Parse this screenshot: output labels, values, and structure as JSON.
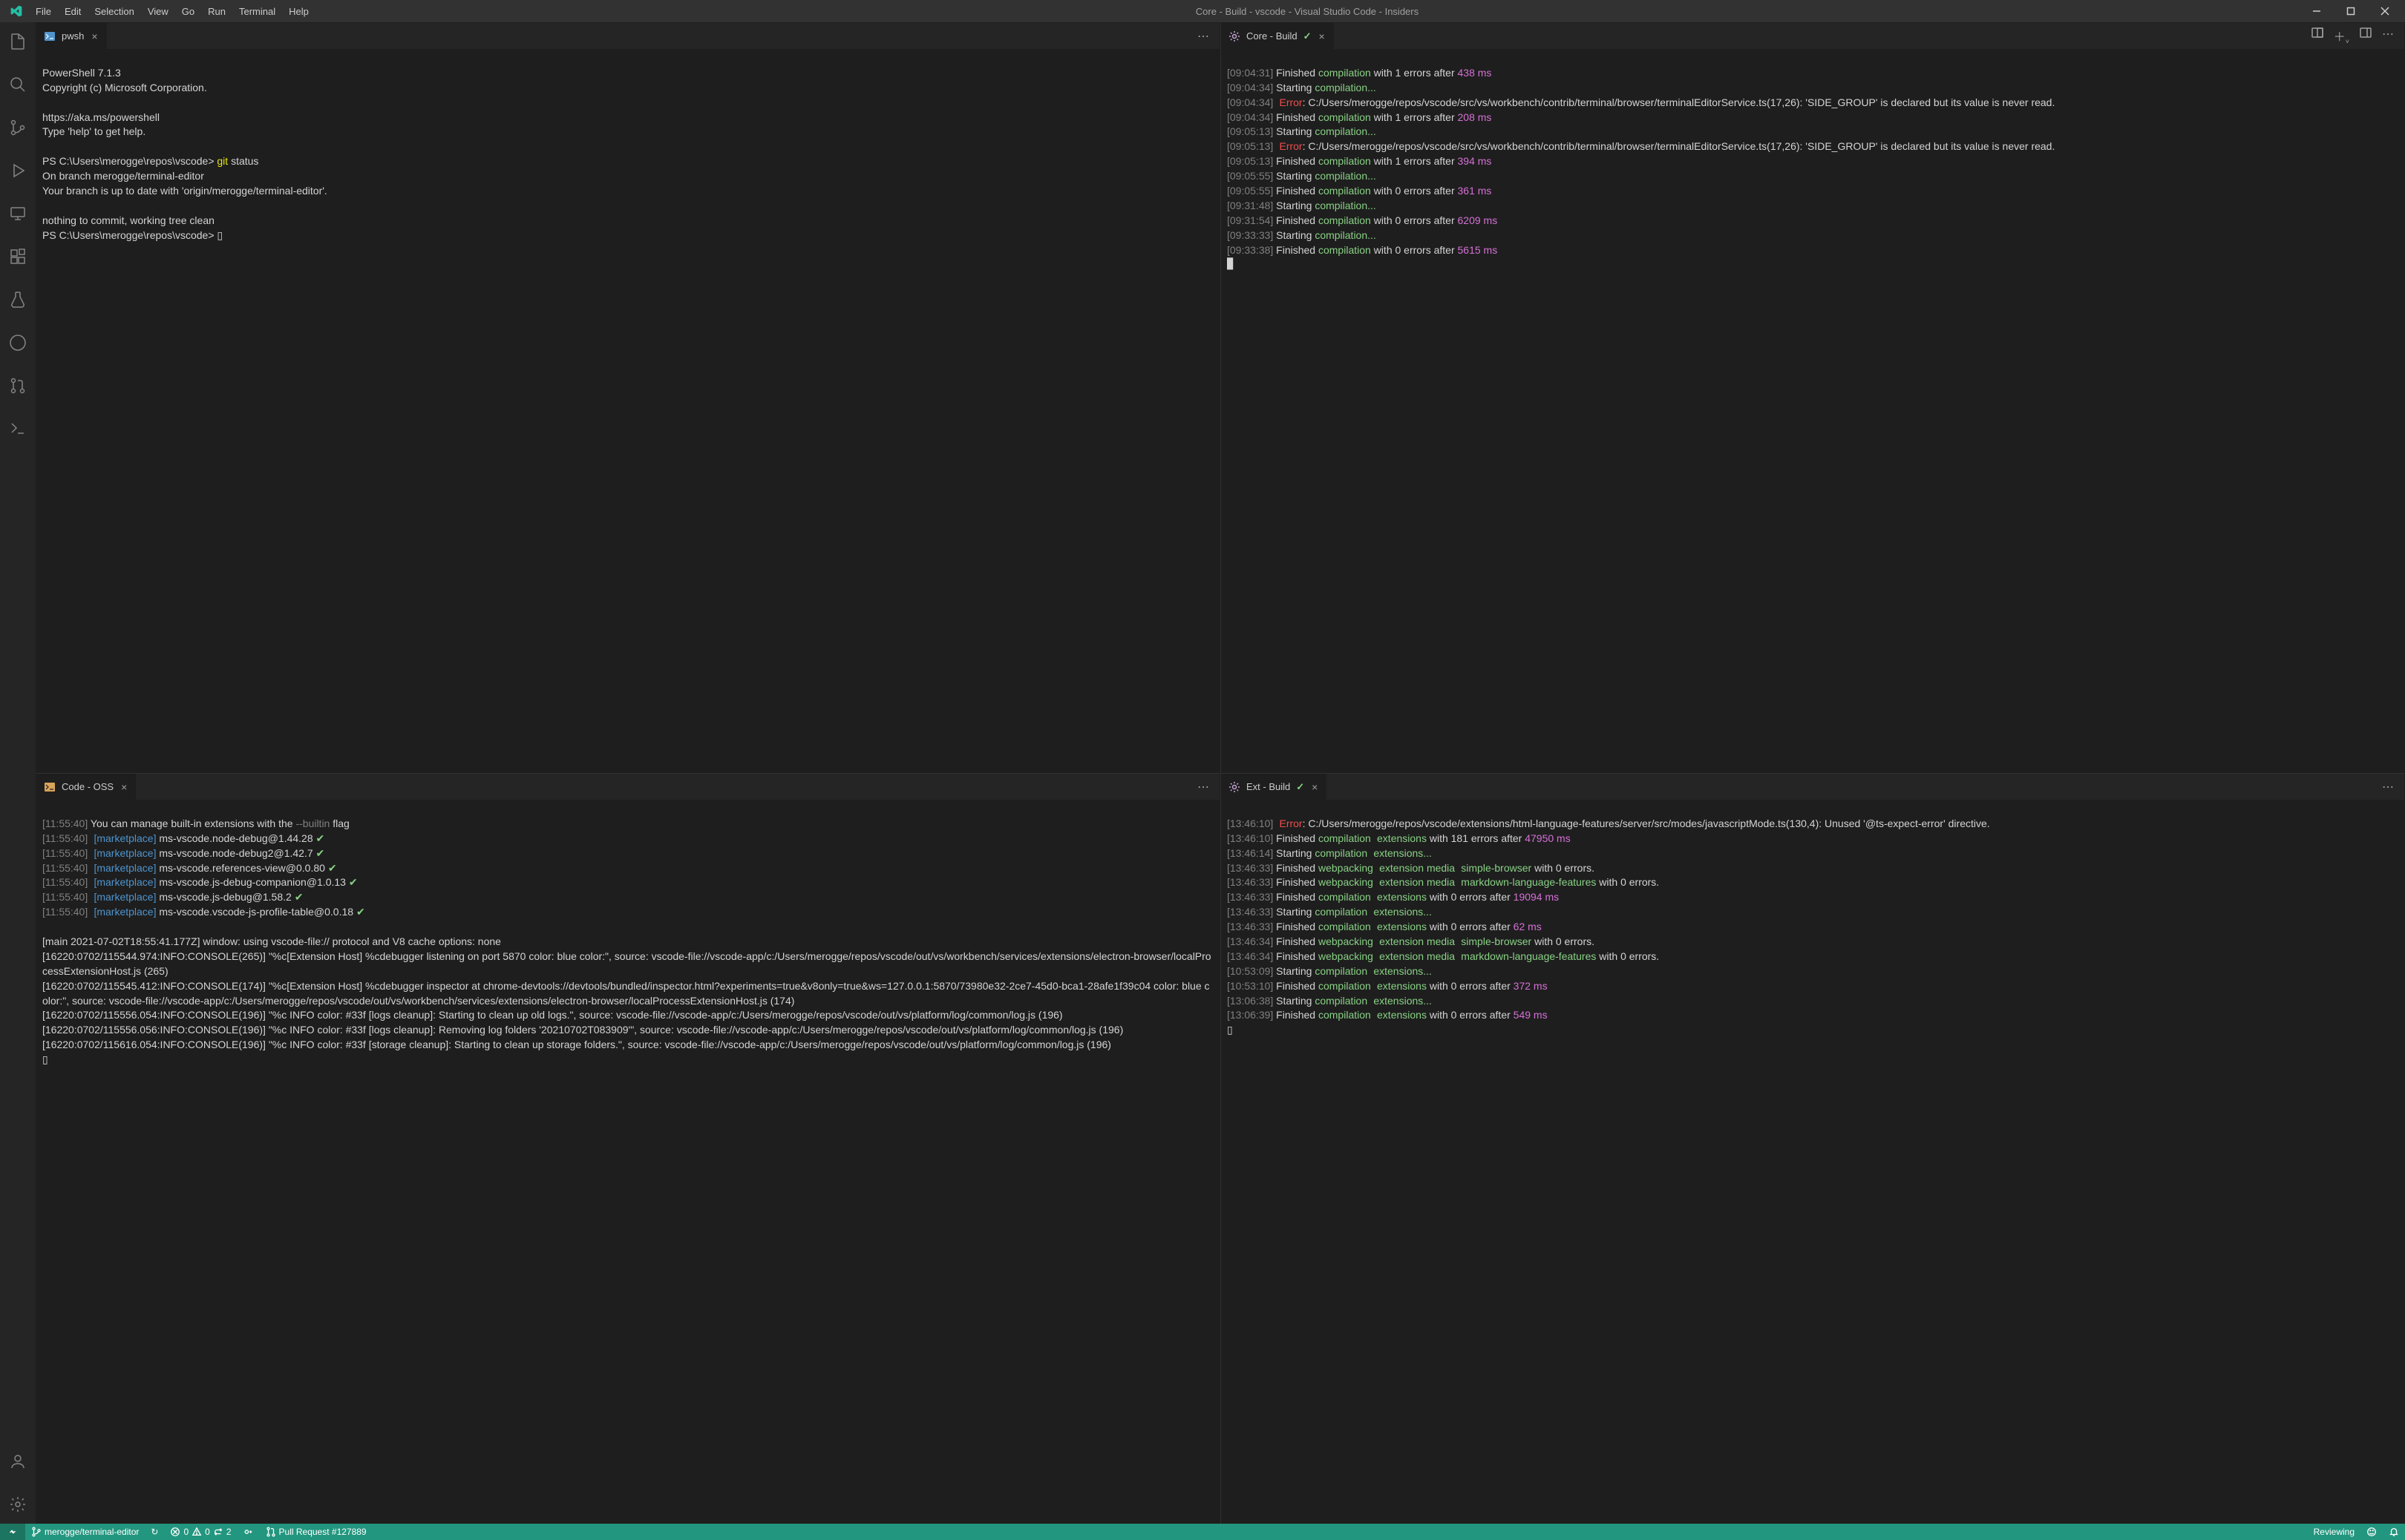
{
  "app": {
    "title": "Core - Build - vscode - Visual Studio Code - Insiders"
  },
  "menu": {
    "items": [
      "File",
      "Edit",
      "Selection",
      "View",
      "Go",
      "Run",
      "Terminal",
      "Help"
    ]
  },
  "panes": {
    "tl": {
      "tab": "pwsh"
    },
    "tr": {
      "tab": "Core - Build"
    },
    "bl": {
      "tab": "Code - OSS"
    },
    "br": {
      "tab": "Ext - Build"
    }
  },
  "term_tl": {
    "l00": "PowerShell 7.1.3",
    "l01": "Copyright (c) Microsoft Corporation.",
    "l02": "",
    "l03": "https://aka.ms/powershell",
    "l04": "Type 'help' to get help.",
    "l05": "",
    "p06": "PS C:\\Users\\merogge\\repos\\vscode> ",
    "c06a": "git",
    "c06b": " status",
    "l07": "On branch merogge/terminal-editor",
    "l08": "Your branch is up to date with 'origin/merogge/terminal-editor'.",
    "l09": "",
    "l10": "nothing to commit, working tree clean",
    "p11": "PS C:\\Users\\merogge\\repos\\vscode> ",
    "cursor": "▯"
  },
  "finished": " Finished ",
  "starting": " Starting ",
  "error_word": "Error",
  "compilation_word": "compilation",
  "compilation_dots": "compilation...",
  "extensions_word": "extensions",
  "extensions_dots": "extensions...",
  "webpacking_word": "webpacking",
  "extension_media": "extension media",
  "term_tr": {
    "r00": {
      "ts": "[09:04:31]",
      "mid": " with 1 errors after ",
      "dur": "438 ms"
    },
    "r01": {
      "ts": "[09:04:34]"
    },
    "r02": {
      "ts": "[09:04:34]",
      "path": ": C:/Users/merogge/repos/vscode/src/vs/workbench/contrib/terminal/browser/terminalEditorService.ts(17,26): 'SIDE_GROUP' is declared but its value is never read."
    },
    "r03": {
      "ts": "[09:04:34]",
      "mid": " with 1 errors after ",
      "dur": "208 ms"
    },
    "r04": {
      "ts": "[09:05:13]"
    },
    "r05": {
      "ts": "[09:05:13]",
      "path": ": C:/Users/merogge/repos/vscode/src/vs/workbench/contrib/terminal/browser/terminalEditorService.ts(17,26): 'SIDE_GROUP' is declared but its value is never read."
    },
    "r06": {
      "ts": "[09:05:13]",
      "mid": " with 1 errors after ",
      "dur": "394 ms"
    },
    "r07": {
      "ts": "[09:05:55]"
    },
    "r08": {
      "ts": "[09:05:55]",
      "mid": " with 0 errors after ",
      "dur": "361 ms"
    },
    "r09": {
      "ts": "[09:31:48]"
    },
    "r10": {
      "ts": "[09:31:54]",
      "mid": " with 0 errors after ",
      "dur": "6209 ms"
    },
    "r11": {
      "ts": "[09:33:33]"
    },
    "r12": {
      "ts": "[09:33:38]",
      "mid": " with 0 errors after ",
      "dur": "5615 ms"
    }
  },
  "term_bl": {
    "r00": {
      "ts": "[11:55:40]",
      "txt1": " You can manage built-in extensions with the ",
      "flag": "--builtin",
      "txt2": " flag"
    },
    "r01": {
      "ts": "[11:55:40]",
      "mp": "[marketplace]",
      "pkg": " ms-vscode.node-debug@1.44.28 ",
      "ok": "✔"
    },
    "r02": {
      "ts": "[11:55:40]",
      "mp": "[marketplace]",
      "pkg": " ms-vscode.node-debug2@1.42.7 ",
      "ok": "✔"
    },
    "r03": {
      "ts": "[11:55:40]",
      "mp": "[marketplace]",
      "pkg": " ms-vscode.references-view@0.0.80 ",
      "ok": "✔"
    },
    "r04": {
      "ts": "[11:55:40]",
      "mp": "[marketplace]",
      "pkg": " ms-vscode.js-debug-companion@1.0.13 ",
      "ok": "✔"
    },
    "r05": {
      "ts": "[11:55:40]",
      "mp": "[marketplace]",
      "pkg": " ms-vscode.js-debug@1.58.2 ",
      "ok": "✔"
    },
    "r06": {
      "ts": "[11:55:40]",
      "mp": "[marketplace]",
      "pkg": " ms-vscode.vscode-js-profile-table@0.0.18 ",
      "ok": "✔"
    },
    "l07": "",
    "l08": "[main 2021-07-02T18:55:41.177Z] window: using vscode-file:// protocol and V8 cache options: none",
    "l09": "[16220:0702/115544.974:INFO:CONSOLE(265)] \"%c[Extension Host] %cdebugger listening on port 5870 color: blue color:\", source: vscode-file://vscode-app/c:/Users/merogge/repos/vscode/out/vs/workbench/services/extensions/electron-browser/localProcessExtensionHost.js (265)",
    "l10": "[16220:0702/115545.412:INFO:CONSOLE(174)] \"%c[Extension Host] %cdebugger inspector at chrome-devtools://devtools/bundled/inspector.html?experiments=true&v8only=true&ws=127.0.0.1:5870/73980e32-2ce7-45d0-bca1-28afe1f39c04 color: blue color:\", source: vscode-file://vscode-app/c:/Users/merogge/repos/vscode/out/vs/workbench/services/extensions/electron-browser/localProcessExtensionHost.js (174)",
    "l11": "[16220:0702/115556.054:INFO:CONSOLE(196)] \"%c INFO color: #33f [logs cleanup]: Starting to clean up old logs.\", source: vscode-file://vscode-app/c:/Users/merogge/repos/vscode/out/vs/platform/log/common/log.js (196)",
    "l12": "[16220:0702/115556.056:INFO:CONSOLE(196)] \"%c INFO color: #33f [logs cleanup]: Removing log folders '20210702T083909'\", source: vscode-file://vscode-app/c:/Users/merogge/repos/vscode/out/vs/platform/log/common/log.js (196)",
    "l13": "[16220:0702/115616.054:INFO:CONSOLE(196)] \"%c INFO color: #33f [storage cleanup]: Starting to clean up storage folders.\", source: vscode-file://vscode-app/c:/Users/merogge/repos/vscode/out/vs/platform/log/common/log.js (196)",
    "cursor": "▯"
  },
  "term_br": {
    "r00": {
      "ts": "[13:46:10]",
      "path": ": C:/Users/merogge/repos/vscode/extensions/html-language-features/server/src/modes/javascriptMode.ts(130,4): Unused '@ts-expect-error' directive."
    },
    "r01": {
      "ts": "[13:46:10]",
      "mid": " with 181 errors after ",
      "dur": "47950 ms"
    },
    "r02": {
      "ts": "[13:46:14]"
    },
    "r03": {
      "ts": "[13:46:33]",
      "name": "simple-browser",
      "tail": " with 0 errors."
    },
    "r04": {
      "ts": "[13:46:33]",
      "name": "markdown-language-features",
      "tail": " with 0 errors."
    },
    "r05": {
      "ts": "[13:46:33]",
      "mid": " with 0 errors after ",
      "dur": "19094 ms"
    },
    "r06": {
      "ts": "[13:46:33]"
    },
    "r07": {
      "ts": "[13:46:33]",
      "mid": " with 0 errors after ",
      "dur": "62 ms"
    },
    "r08": {
      "ts": "[13:46:34]",
      "name": "simple-browser",
      "tail": " with 0 errors."
    },
    "r09": {
      "ts": "[13:46:34]",
      "name": "markdown-language-features",
      "tail": " with 0 errors."
    },
    "r10": {
      "ts": "[10:53:09]"
    },
    "r11": {
      "ts": "[10:53:10]",
      "mid": " with 0 errors after ",
      "dur": "372 ms"
    },
    "r12": {
      "ts": "[13:06:38]"
    },
    "r13": {
      "ts": "[13:06:39]",
      "mid": " with 0 errors after ",
      "dur": "549 ms"
    },
    "cursor": "▯"
  },
  "status": {
    "branch": "merogge/terminal-editor",
    "sync": "↻",
    "errors": "0",
    "warnings": "0",
    "diffs": "2",
    "pr": "Pull Request #127889",
    "mode": "Reviewing"
  }
}
